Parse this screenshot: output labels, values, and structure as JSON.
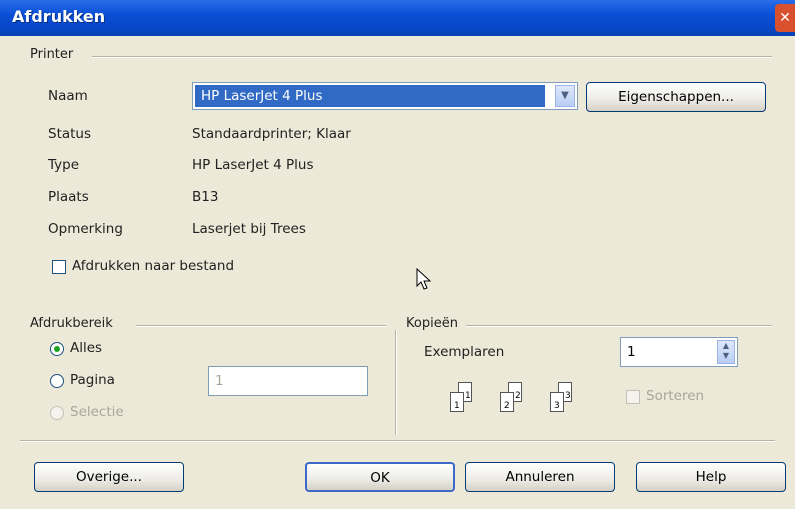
{
  "window": {
    "title": "Afdrukken",
    "close_glyph": "✕"
  },
  "printer": {
    "group_label": "Printer",
    "name_label": "Naam",
    "name_value": "HP LaserJet 4 Plus",
    "properties_button": "Eigenschappen...",
    "status_label": "Status",
    "status_value": "Standaardprinter; Klaar",
    "type_label": "Type",
    "type_value": "HP LaserJet 4 Plus",
    "location_label": "Plaats",
    "location_value": "B13",
    "comment_label": "Opmerking",
    "comment_value": "Laserjet bij Trees",
    "print_to_file_label": "Afdrukken naar bestand",
    "print_to_file_checked": false
  },
  "range": {
    "group_label": "Afdrukbereik",
    "all_label": "Alles",
    "pages_label": "Pagina",
    "pages_value": "1",
    "selection_label": "Selectie",
    "selected": "all"
  },
  "copies": {
    "group_label": "Kopieën",
    "count_label": "Exemplaren",
    "count_value": "1",
    "collate_label": "Sorteren",
    "collate_checked": false,
    "page_icons": [
      {
        "back": "1",
        "front": "1"
      },
      {
        "back": "2",
        "front": "2"
      },
      {
        "back": "3",
        "front": "3"
      }
    ]
  },
  "buttons": {
    "other": "Overige...",
    "ok": "OK",
    "cancel": "Annuleren",
    "help": "Help"
  },
  "colors": {
    "title_bar": "#0a4fd6",
    "selection": "#316ac5",
    "dialog_bg": "#ece9d8"
  }
}
